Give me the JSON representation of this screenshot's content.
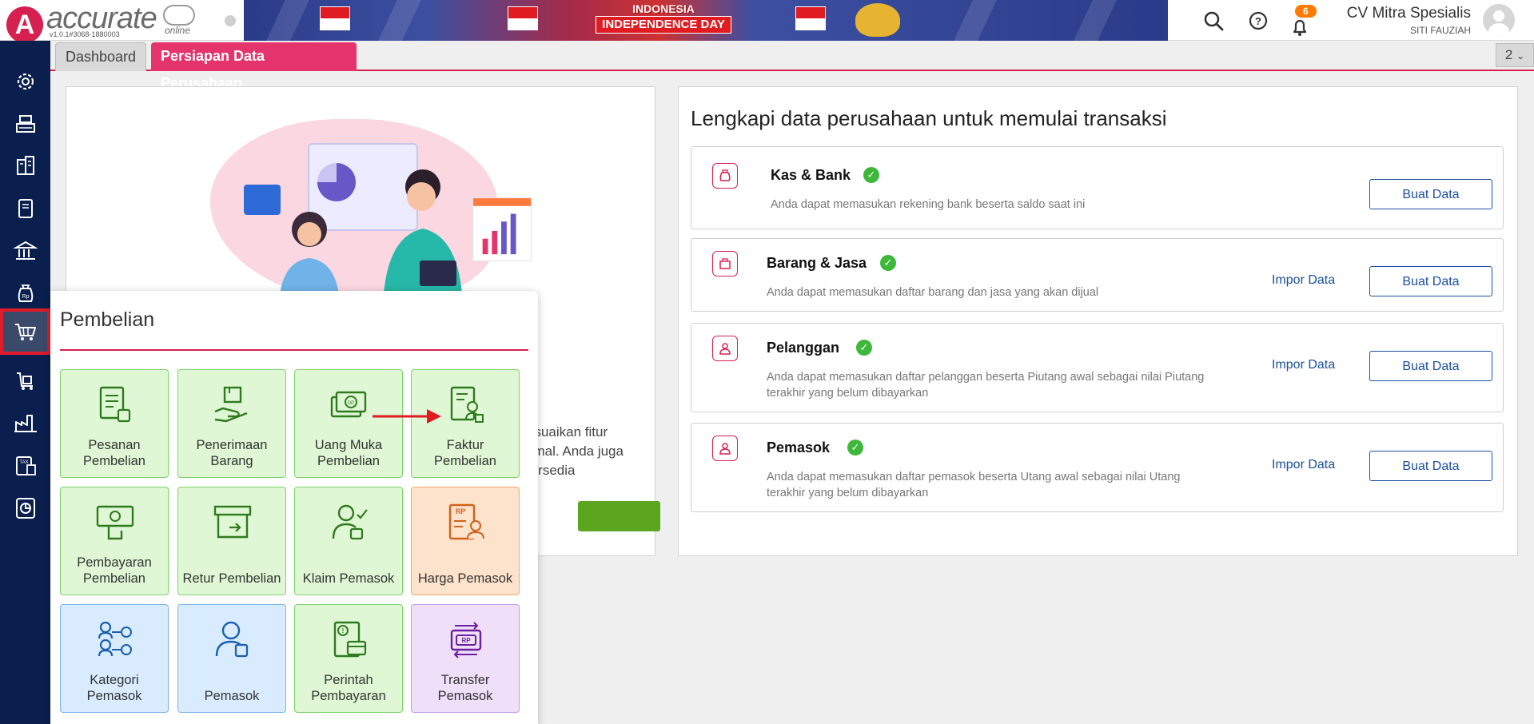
{
  "header": {
    "logo_letter": "A",
    "app_name": "accurate",
    "app_suffix": "online",
    "version": "v1.0.1#3068-1880003",
    "banner_line1": "INDONESIA",
    "banner_line2": "INDEPENDENCE DAY",
    "notification_count": "6",
    "company_name": "CV Mitra Spesialis",
    "user_name": "SITI FAUZIAH"
  },
  "tabs": {
    "dashboard": "Dashboard",
    "persiapan": "Persiapan Data Perusahaan",
    "open_count": "2"
  },
  "left_card": {
    "text_line1": "esuaikan fitur",
    "text_line2": "timal. Anda juga",
    "text_line3": "tersedia"
  },
  "right_card": {
    "title": "Lengkapi data perusahaan untuk memulai transaksi",
    "rows": [
      {
        "title": "Kas & Bank",
        "desc1": "Anda dapat memasukan rekening bank beserta saldo saat ini",
        "desc2": "",
        "impor": "",
        "buat": "Buat Data"
      },
      {
        "title": "Barang & Jasa",
        "desc1": "Anda dapat memasukan daftar barang dan jasa yang akan dijual",
        "desc2": "",
        "impor": "Impor Data",
        "buat": "Buat Data"
      },
      {
        "title": "Pelanggan",
        "desc1": "Anda dapat memasukan daftar pelanggan beserta Piutang awal sebagai nilai Piutang",
        "desc2": "terakhir yang belum dibayarkan",
        "impor": "Impor Data",
        "buat": "Buat Data"
      },
      {
        "title": "Pemasok",
        "desc1": "Anda dapat memasukan daftar pemasok beserta Utang awal sebagai nilai Utang",
        "desc2": "terakhir yang belum dibayarkan",
        "impor": "Impor Data",
        "buat": "Buat Data"
      }
    ]
  },
  "panel": {
    "title": "Pembelian",
    "tiles": [
      {
        "line1": "Pesanan",
        "line2": "Pembelian",
        "icon": "purchase-order-icon"
      },
      {
        "line1": "Penerimaan",
        "line2": "Barang",
        "icon": "goods-receipt-icon"
      },
      {
        "line1": "Uang Muka",
        "line2": "Pembelian",
        "icon": "down-payment-icon"
      },
      {
        "line1": "Faktur",
        "line2": "Pembelian",
        "icon": "purchase-invoice-icon"
      },
      {
        "line1": "Pembayaran",
        "line2": "Pembelian",
        "icon": "purchase-payment-icon"
      },
      {
        "line1": "",
        "line2": "Retur Pembelian",
        "icon": "purchase-return-icon"
      },
      {
        "line1": "",
        "line2": "Klaim Pemasok",
        "icon": "vendor-claim-icon"
      },
      {
        "line1": "",
        "line2": "Harga Pemasok",
        "icon": "vendor-price-icon"
      },
      {
        "line1": "Kategori",
        "line2": "Pemasok",
        "icon": "vendor-category-icon"
      },
      {
        "line1": "",
        "line2": "Pemasok",
        "icon": "vendor-icon"
      },
      {
        "line1": "Perintah",
        "line2": "Pembayaran",
        "icon": "payment-order-icon"
      },
      {
        "line1": "Transfer",
        "line2": "Pemasok",
        "icon": "vendor-transfer-icon"
      }
    ]
  },
  "colors": {
    "brand": "#d6204f",
    "sidebar": "#0a1f4e",
    "link": "#1b4fa0",
    "check": "#3db83b"
  }
}
